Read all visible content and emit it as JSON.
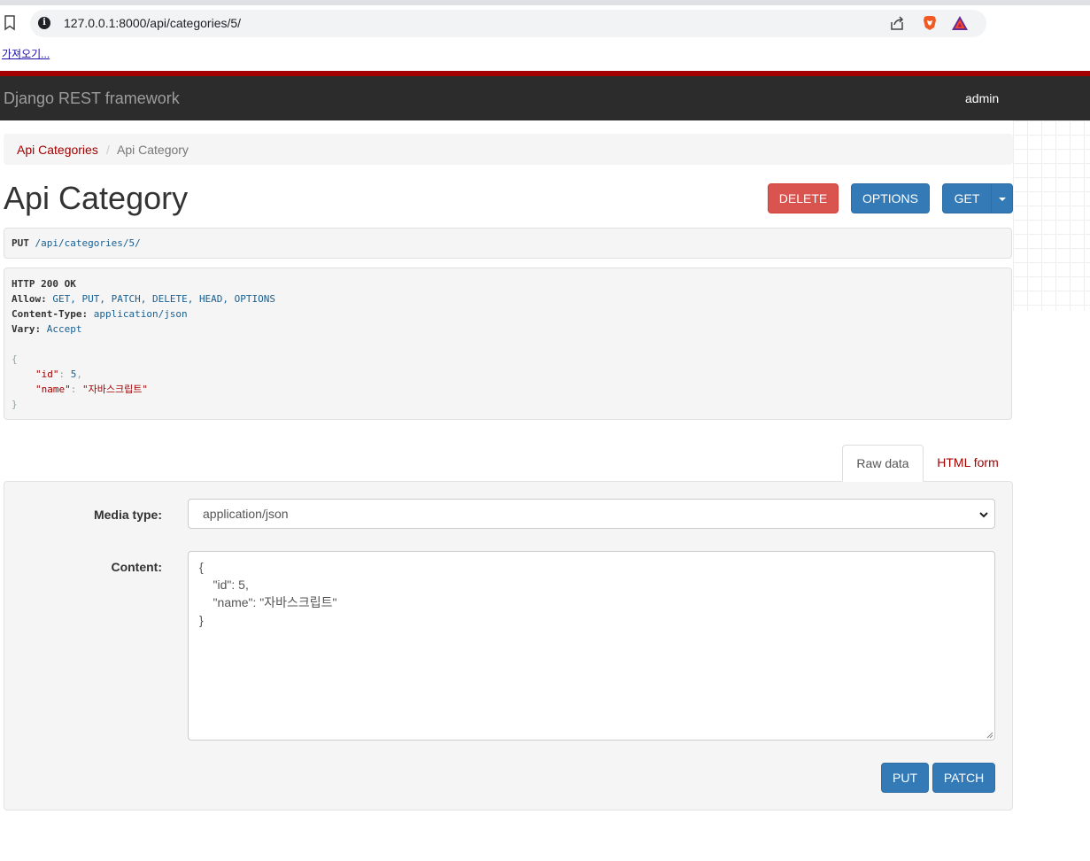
{
  "browser": {
    "url": "127.0.0.1:8000/api/categories/5/",
    "import_link": "가져오기..."
  },
  "navbar": {
    "brand": "Django REST framework",
    "user": "admin"
  },
  "breadcrumb": {
    "items": [
      "Api Categories",
      "Api Category"
    ],
    "separator": "/"
  },
  "page": {
    "title": "Api Category"
  },
  "actions": {
    "delete": "DELETE",
    "options": "OPTIONS",
    "get": "GET"
  },
  "request": {
    "method": "PUT",
    "path": "/api/categories/5/"
  },
  "response": {
    "status": "HTTP 200 OK",
    "headers": [
      {
        "name": "Allow:",
        "value": "GET, PUT, PATCH, DELETE, HEAD, OPTIONS"
      },
      {
        "name": "Content-Type:",
        "value": "application/json"
      },
      {
        "name": "Vary:",
        "value": "Accept"
      }
    ],
    "body": {
      "open": "{",
      "close": "}",
      "fields": [
        {
          "key": "\"id\"",
          "value": "5",
          "trail": ","
        },
        {
          "key": "\"name\"",
          "value": "\"자바스크립트\"",
          "trail": ""
        }
      ]
    }
  },
  "form": {
    "tabs": [
      "Raw data",
      "HTML form"
    ],
    "media_type_label": "Media type:",
    "media_type_value": "application/json",
    "content_label": "Content:",
    "content_lines": [
      "{",
      "    \"id\": 5,",
      "    \"name\": \"자바스크립트\"",
      "}"
    ],
    "put": "PUT",
    "patch": "PATCH"
  },
  "colors": {
    "navbar_bg": "#2c2c2c",
    "accent_red": "#a30000",
    "primary_blue": "#337ab7",
    "danger_red": "#d9534f"
  }
}
